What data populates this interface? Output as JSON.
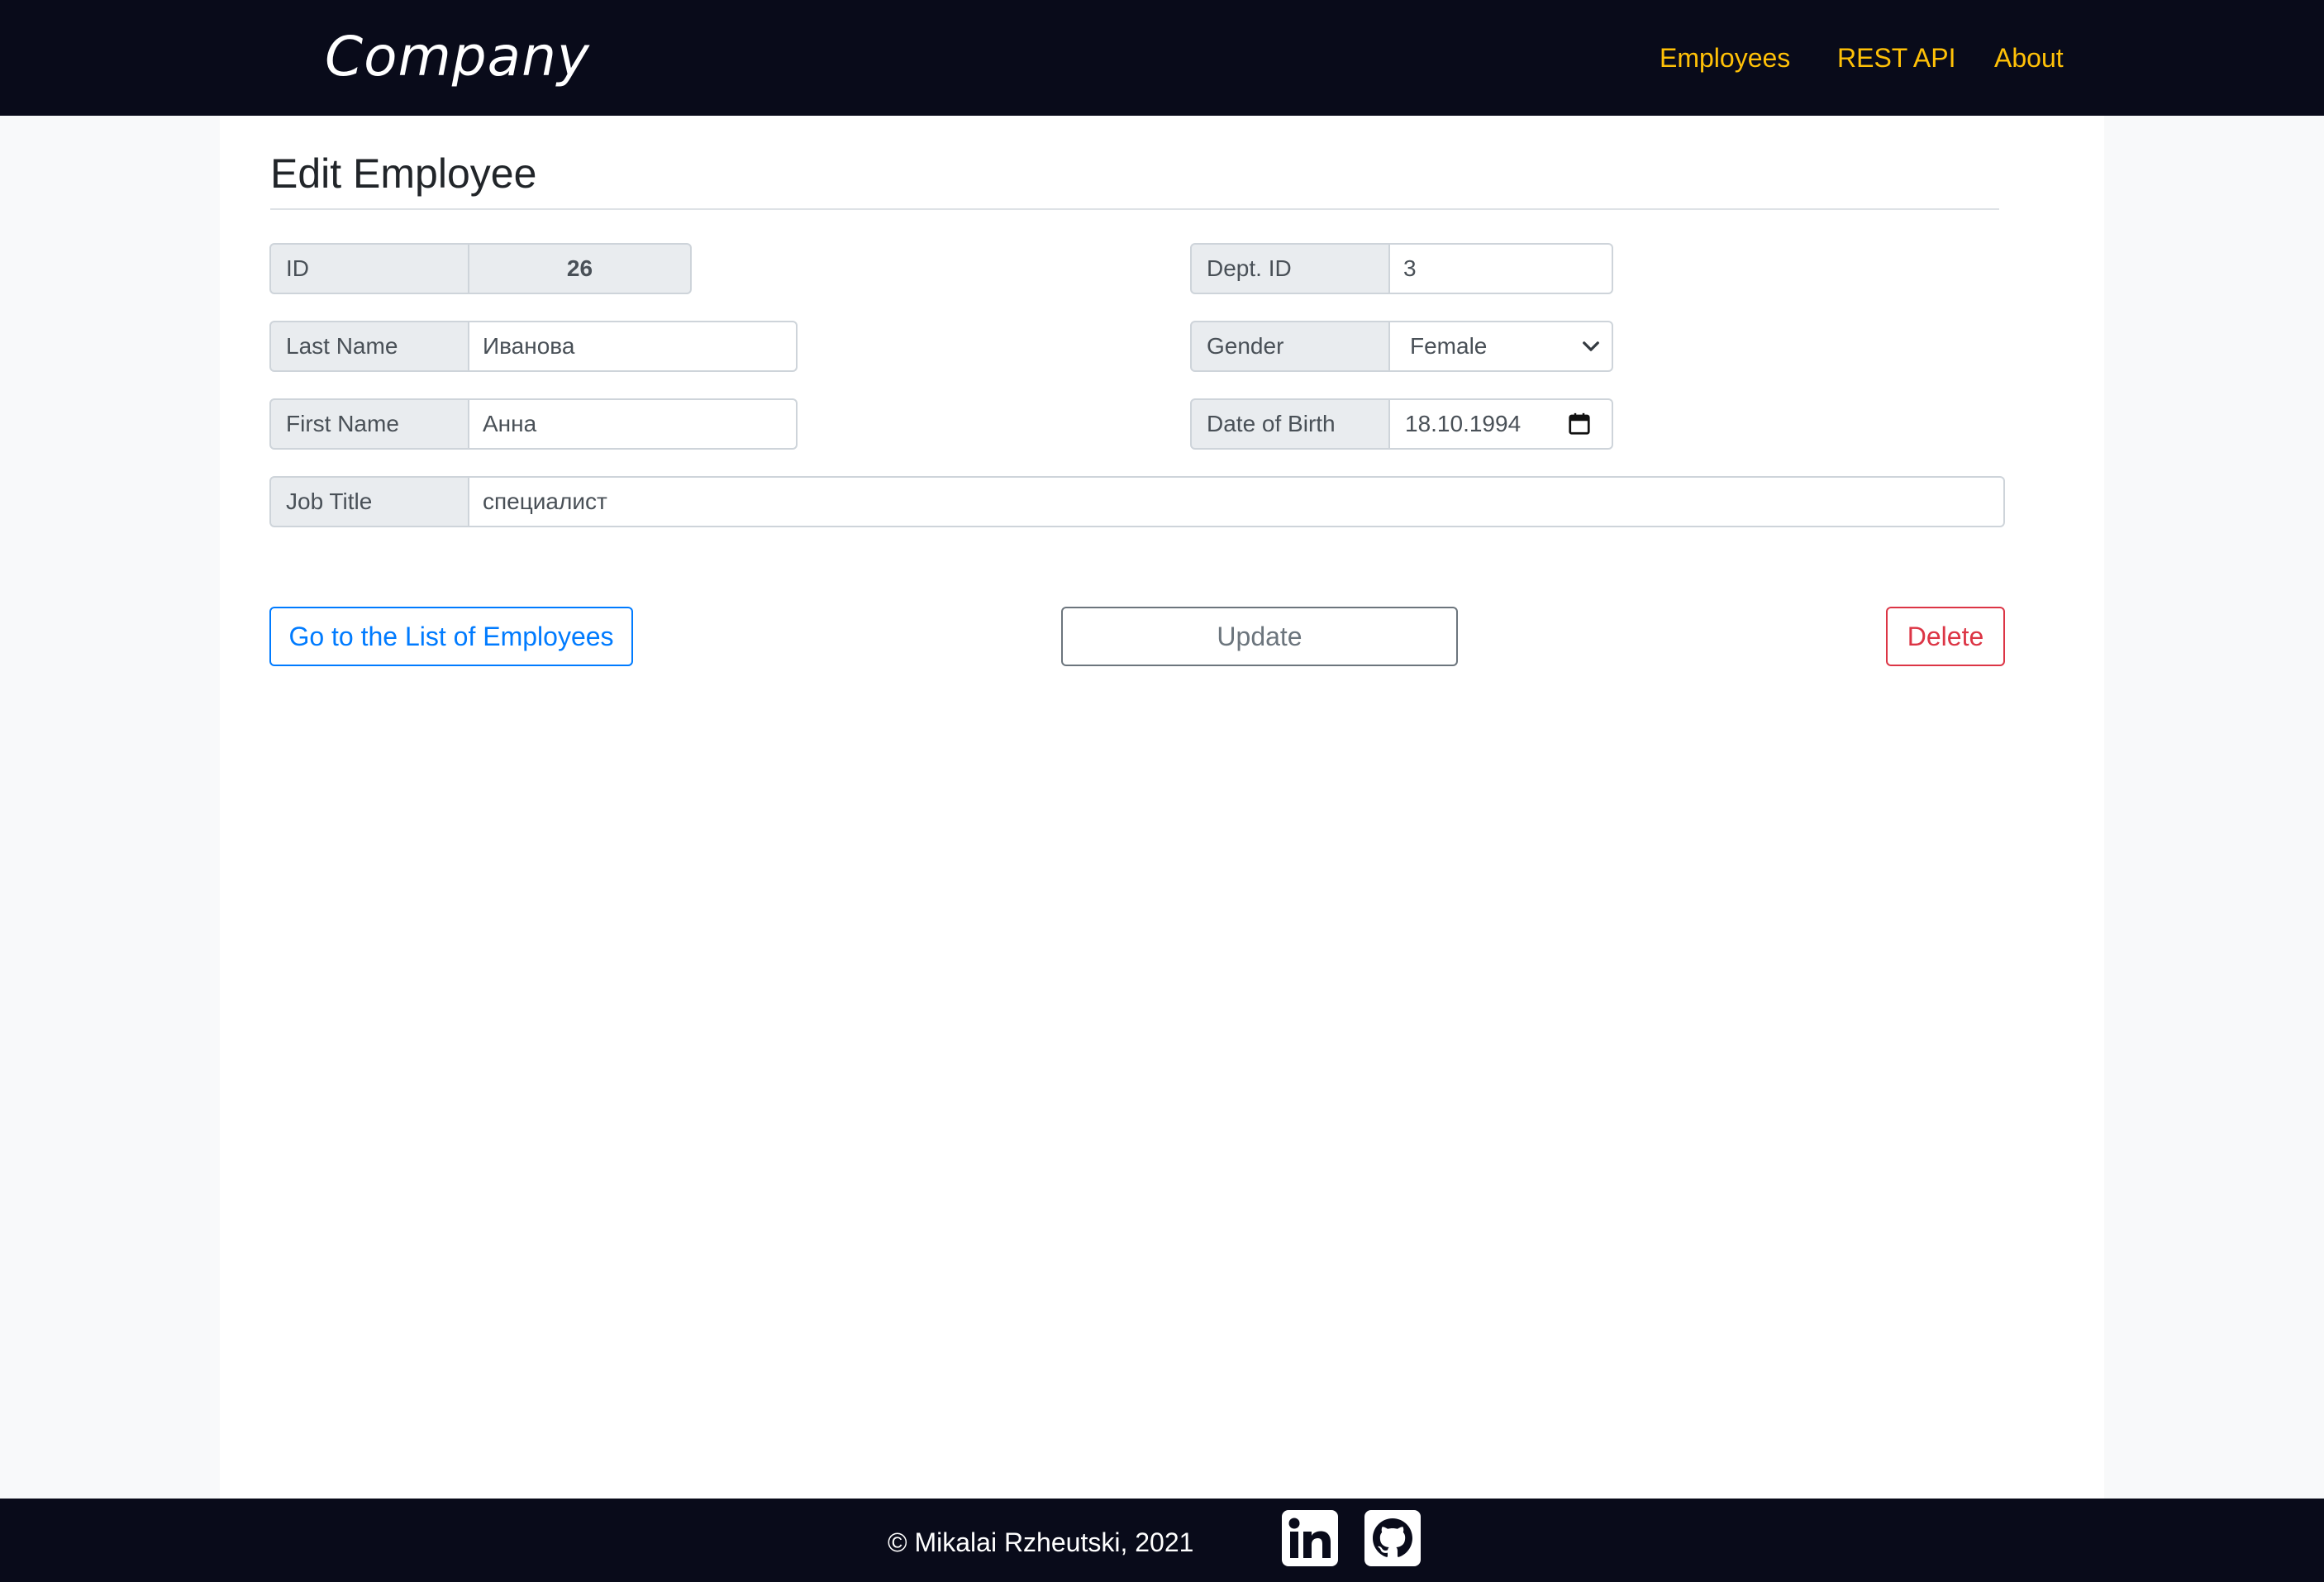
{
  "header": {
    "brand": "Company",
    "nav": {
      "employees": "Employees",
      "rest_api": "REST API",
      "about": "About"
    },
    "nav_color": "#ffc107",
    "background_color": "#090b1a"
  },
  "page": {
    "title": "Edit Employee"
  },
  "form": {
    "id": {
      "label": "ID",
      "value": "26"
    },
    "dept_id": {
      "label": "Dept. ID",
      "value": "3"
    },
    "last_name": {
      "label": "Last Name",
      "value": "Иванова"
    },
    "gender": {
      "label": "Gender",
      "value": "Female"
    },
    "first_name": {
      "label": "First Name",
      "value": "Анна"
    },
    "date_of_birth": {
      "label": "Date of Birth",
      "value": "18.10.1994"
    },
    "job_title": {
      "label": "Job Title",
      "value": "специалист"
    }
  },
  "actions": {
    "list_label": "Go to the List of Employees",
    "update_label": "Update",
    "delete_label": "Delete"
  },
  "footer": {
    "copyright": "© Mikalai Rzheutski, 2021",
    "icons": [
      "linkedin-icon",
      "github-icon"
    ]
  },
  "colors": {
    "primary": "#007bff",
    "secondary": "#6c757d",
    "danger": "#dc3545"
  }
}
